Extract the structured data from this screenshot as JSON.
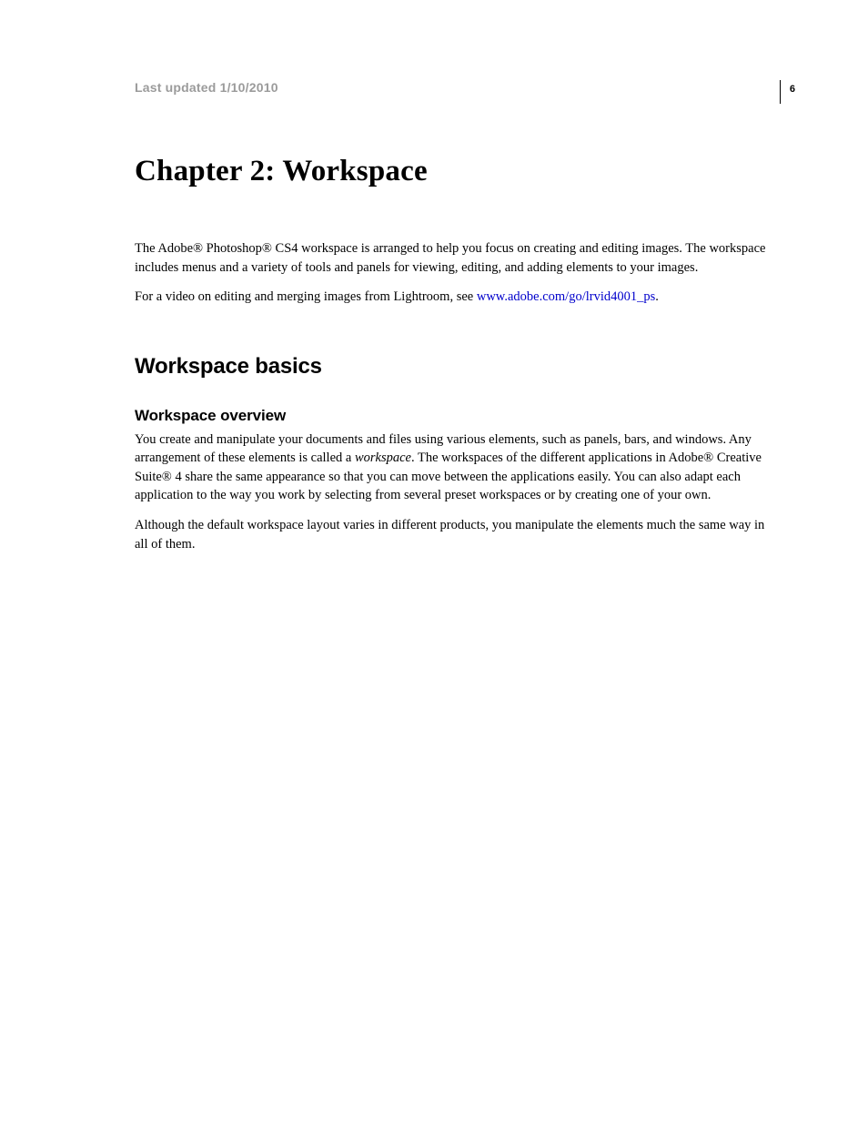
{
  "header": {
    "last_updated": "Last updated 1/10/2010",
    "page_number": "6"
  },
  "chapter_title": "Chapter 2: Workspace",
  "intro": {
    "para1": "The Adobe® Photoshop® CS4 workspace is arranged to help you focus on creating and editing images. The workspace includes menus and a variety of tools and panels for viewing, editing, and adding elements to your images.",
    "para2_prefix": "For a video on editing and merging images from Lightroom, see ",
    "para2_link": "www.adobe.com/go/lrvid4001_ps",
    "para2_suffix": "."
  },
  "section": {
    "heading": "Workspace basics",
    "subsection_heading": "Workspace overview",
    "para1_a": "You create and manipulate your documents and files using various elements, such as panels, bars, and windows. Any arrangement of these elements is called a ",
    "para1_italic": "workspace",
    "para1_b": ". The workspaces of the different applications in Adobe® Creative Suite® 4 share the same appearance so that you can move between the applications easily. You can also adapt each application to the way you work by selecting from several preset workspaces or by creating one of your own.",
    "para2": "Although the default workspace layout varies in different products, you manipulate the elements much the same way in all of them."
  }
}
